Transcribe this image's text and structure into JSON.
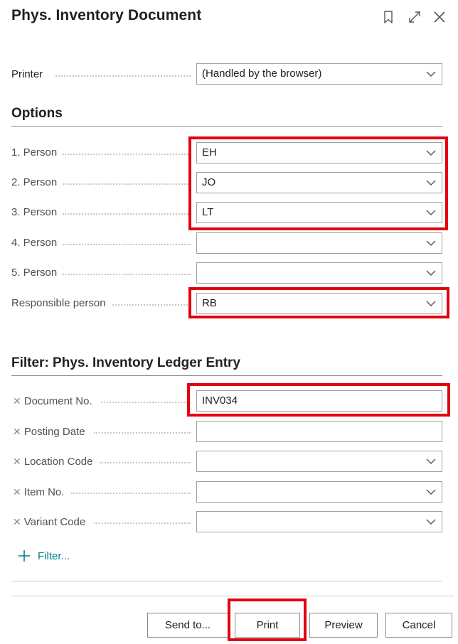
{
  "header": {
    "title": "Phys. Inventory Document",
    "icons": [
      "bookmark-icon",
      "expand-icon",
      "close-icon"
    ]
  },
  "printer": {
    "label": "Printer",
    "value": "(Handled by the browser)"
  },
  "options": {
    "heading": "Options",
    "person1": {
      "label": "1. Person",
      "value": "EH"
    },
    "person2": {
      "label": "2. Person",
      "value": "JO"
    },
    "person3": {
      "label": "3. Person",
      "value": "LT"
    },
    "person4": {
      "label": "4. Person",
      "value": ""
    },
    "person5": {
      "label": "5. Person",
      "value": ""
    },
    "responsible": {
      "label": "Responsible person",
      "value": "RB"
    }
  },
  "filter": {
    "heading": "Filter: Phys. Inventory Ledger Entry",
    "document_no": {
      "label": "Document No.",
      "value": "INV034"
    },
    "posting_date": {
      "label": "Posting Date",
      "value": ""
    },
    "location_code": {
      "label": "Location Code",
      "value": ""
    },
    "item_no": {
      "label": "Item No.",
      "value": ""
    },
    "variant_code": {
      "label": "Variant Code",
      "value": ""
    },
    "add_filter_label": "Filter..."
  },
  "footer": {
    "send_to": "Send to...",
    "print": "Print",
    "preview": "Preview",
    "cancel": "Cancel"
  },
  "colors": {
    "highlight": "#e3000f",
    "link": "#00808a"
  }
}
